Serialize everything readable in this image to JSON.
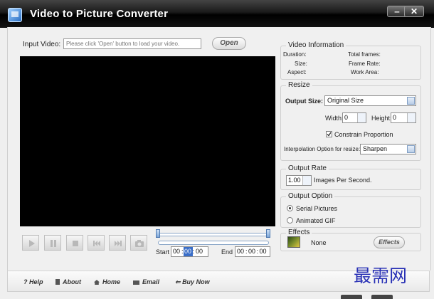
{
  "window": {
    "title": "Video to Picture Converter",
    "minimize_label": "‒",
    "close_label": "✕"
  },
  "input": {
    "label": "Input Video:",
    "placeholder": "Please click 'Open' button to load your video.",
    "open_button": "Open"
  },
  "timeline": {
    "start_label": "Start",
    "end_label": "End",
    "start": [
      "00",
      "00",
      "00"
    ],
    "end": [
      "00",
      "00",
      "00"
    ],
    "separator": ":"
  },
  "video_information": {
    "title": "Video Information",
    "duration_label": "Duration:",
    "size_label": "Size:",
    "aspect_label": "Aspect:",
    "total_frames_label": "Total frames:",
    "frame_rate_label": "Frame Rate:",
    "work_area_label": "Work Area:"
  },
  "resize": {
    "title": "Resize",
    "output_size_label": "Output Size:",
    "output_size_value": "Original Size",
    "width_label": "Width:",
    "width_value": "0",
    "height_label": "Height:",
    "height_value": "0",
    "constrain_label": "Constrain Proportion",
    "constrain_checked": true,
    "interpolation_label": "Interpolation Option for resize:",
    "interpolation_value": "Sharpen"
  },
  "output_rate": {
    "title": "Output Rate",
    "value": "1.00",
    "unit_label": "Images Per Second."
  },
  "output_option": {
    "title": "Output Option",
    "serial_label": "Serial Pictures",
    "gif_label": "Animated GIF",
    "selected": "Serial Pictures"
  },
  "effects": {
    "title": "Effects",
    "value": "None",
    "button": "Effects"
  },
  "bottom_nav": {
    "help": "Help",
    "about": "About",
    "home": "Home",
    "email": "Email",
    "buy": "Buy Now"
  },
  "watermark": "最需网",
  "colors": {
    "titlebar": "#000000",
    "video_bg": "#000000",
    "watermark": "#2830b5"
  }
}
